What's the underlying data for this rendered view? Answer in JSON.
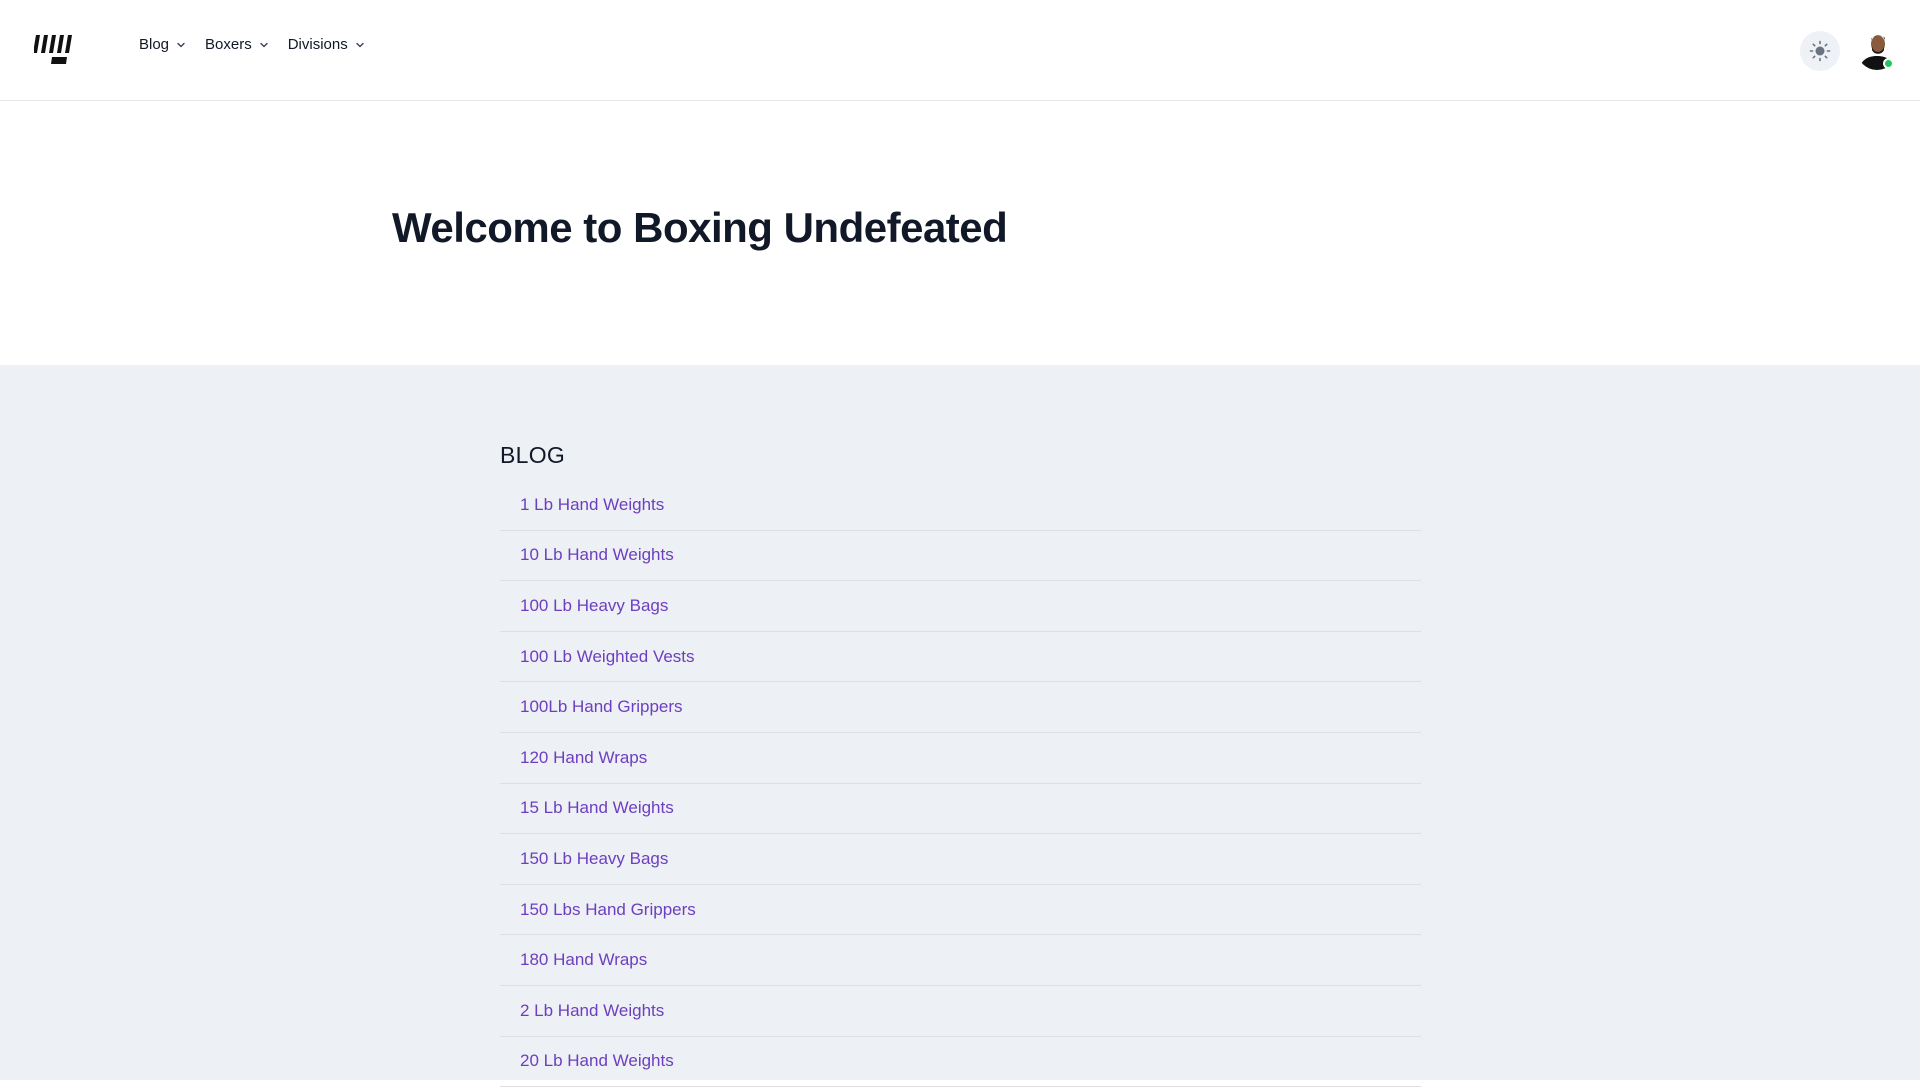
{
  "header": {
    "logo_icon": "brand-logo-icon",
    "nav": [
      {
        "label": "Blog",
        "icon": "chevron-down-icon"
      },
      {
        "label": "Boxers",
        "icon": "chevron-down-icon"
      },
      {
        "label": "Divisions",
        "icon": "chevron-down-icon"
      }
    ],
    "theme_toggle_icon": "sun-icon",
    "avatar_icon": "user-avatar",
    "status_color": "#22c55e"
  },
  "hero": {
    "title": "Welcome to Boxing Undefeated"
  },
  "blog": {
    "heading": "BLOG",
    "items": [
      "1 Lb Hand Weights",
      "10 Lb Hand Weights",
      "100 Lb Heavy Bags",
      "100 Lb Weighted Vests",
      "100Lb Hand Grippers",
      "120 Hand Wraps",
      "15 Lb Hand Weights",
      "150 Lb Heavy Bags",
      "150 Lbs Hand Grippers",
      "180 Hand Wraps",
      "2 Lb Hand Weights",
      "20 Lb Hand Weights"
    ]
  },
  "colors": {
    "link": "#6d3fc0",
    "content_bg": "#edf0f4",
    "heading": "#111827"
  }
}
